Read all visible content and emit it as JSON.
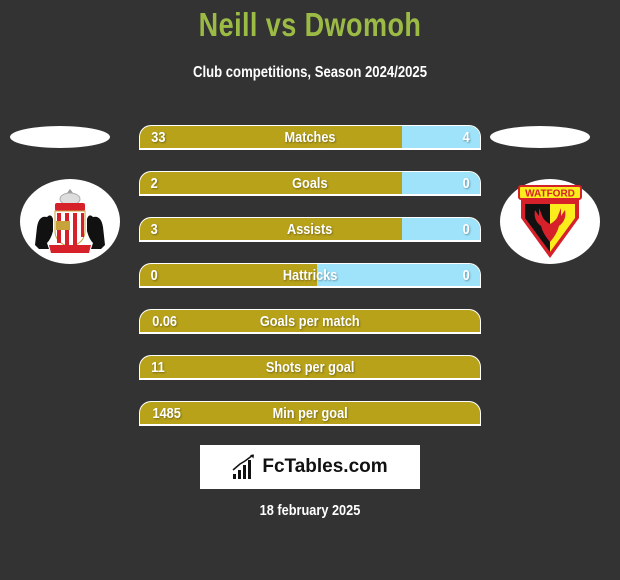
{
  "header": {
    "title": "Neill vs Dwomoh",
    "subtitle": "Club competitions, Season 2024/2025"
  },
  "teams": {
    "left": {
      "name": "Sunderland",
      "logo_icon": "sunderland-crest-icon"
    },
    "right": {
      "name": "Watford",
      "logo_icon": "watford-crest-icon",
      "logo_text": "WATFORD"
    }
  },
  "colors": {
    "background": "#333333",
    "title": "#9cbb44",
    "left_bar": "#b8a21a",
    "right_bar": "#9fe3fb"
  },
  "stats": [
    {
      "label": "Matches",
      "left": "33",
      "right": "4",
      "right_share": 0.23
    },
    {
      "label": "Goals",
      "left": "2",
      "right": "0",
      "right_share": 0.23
    },
    {
      "label": "Assists",
      "left": "3",
      "right": "0",
      "right_share": 0.23
    },
    {
      "label": "Hattricks",
      "left": "0",
      "right": "0",
      "right_share": 0.48
    },
    {
      "label": "Goals per match",
      "left": "0.06",
      "right": "",
      "right_share": 0
    },
    {
      "label": "Shots per goal",
      "left": "11",
      "right": "",
      "right_share": 0
    },
    {
      "label": "Min per goal",
      "left": "1485",
      "right": "",
      "right_share": 0
    }
  ],
  "brand": {
    "name": "FcTables.com",
    "icon": "bar-chart-icon"
  },
  "footer": {
    "date": "18 february 2025"
  }
}
